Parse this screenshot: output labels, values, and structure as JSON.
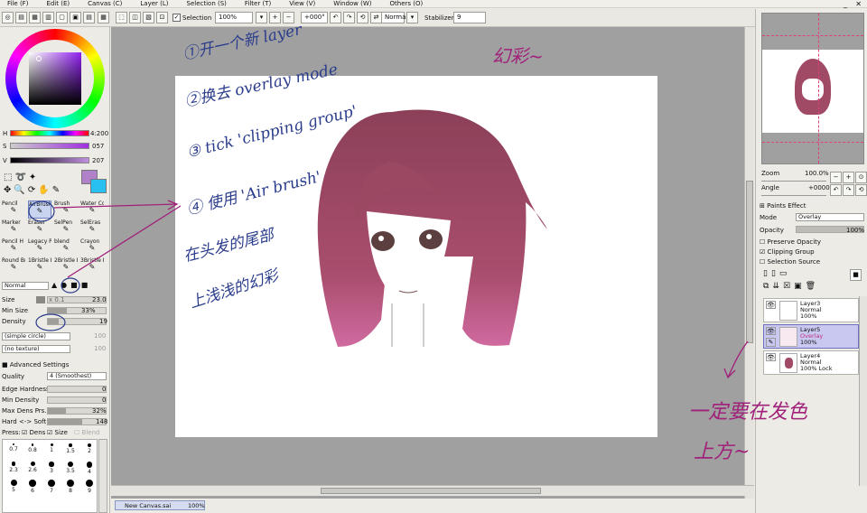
{
  "menu": [
    "File (F)",
    "Edit (E)",
    "Canvas (C)",
    "Layer (L)",
    "Selection (S)",
    "Filter (T)",
    "View (V)",
    "Window (W)",
    "Others (O)"
  ],
  "toolbar": {
    "selection_label": "Selection",
    "zoom_value": "100%",
    "rotation_value": "+000°",
    "blend_value": "Normal",
    "stabilizer_label": "Stabilizer",
    "stabilizer_value": "9"
  },
  "color": {
    "h_label": "H",
    "h_value": "4:200",
    "s_label": "S",
    "s_value": "057",
    "v_label": "V",
    "v_value": "207",
    "primary": "#b080c8",
    "secondary": "#28c0f0"
  },
  "brushes": [
    {
      "name": "Pencil"
    },
    {
      "name": "AirBrush"
    },
    {
      "name": "Brush"
    },
    {
      "name": "Water Color"
    },
    {
      "name": "Marker"
    },
    {
      "name": "Eraser"
    },
    {
      "name": "SelPen"
    },
    {
      "name": "SelEras"
    },
    {
      "name": "Pencil H"
    },
    {
      "name": "Legacy Pen"
    },
    {
      "name": "blend"
    },
    {
      "name": "Crayon"
    },
    {
      "name": "Round Brush"
    },
    {
      "name": "1Bristle Brush"
    },
    {
      "name": "2Bristle Brush"
    },
    {
      "name": "3Bristle Brush"
    }
  ],
  "brush_settings": {
    "mode": "Normal",
    "size_label": "Size",
    "size_mult": "x 0.1",
    "size_value": "23.0",
    "minsize_label": "Min Size",
    "minsize_value": "33%",
    "density_label": "Density",
    "density_value": "19",
    "shape": "(simple circle)",
    "shape_value": "100",
    "texture": "(no texture)",
    "texture_value": "100",
    "advanced_label": "Advanced Settings",
    "quality_label": "Quality",
    "quality_value": "4 (Smoothest)",
    "edge_label": "Edge Hardness",
    "edge_value": "0",
    "mindens_label": "Min Density",
    "mindens_value": "0",
    "maxdens_label": "Max Dens Prs.",
    "maxdens_value": "32%",
    "hardsoft_label": "Hard <-> Soft",
    "hardsoft_value": "148",
    "press_label": "Press:",
    "press_dens": "Dens",
    "press_size": "Size",
    "press_blend": "Blend"
  },
  "size_presets": [
    "0.7",
    "0.8",
    "1",
    "1.5",
    "2",
    "2.3",
    "2.6",
    "3",
    "3.5",
    "4",
    "5",
    "6",
    "7",
    "8",
    "9"
  ],
  "navigator": {
    "zoom_label": "Zoom",
    "zoom_value": "100.0%",
    "angle_label": "Angle",
    "angle_value": "+0000"
  },
  "layer_panel": {
    "paints_effect": "Paints Effect",
    "mode_label": "Mode",
    "mode_value": "Overlay",
    "opacity_label": "Opacity",
    "opacity_value": "100%",
    "preserve_opacity": "Preserve Opacity",
    "clipping_group": "Clipping Group",
    "selection_source": "Selection Source",
    "layers": [
      {
        "name": "Layer3",
        "mode": "Normal",
        "opacity": "100%"
      },
      {
        "name": "Layer5",
        "mode": "Overlay",
        "opacity": "100%"
      },
      {
        "name": "Layer4",
        "mode": "Normal",
        "opacity": "100% Lock"
      }
    ]
  },
  "status": {
    "doc_name": "New Canvas.sai",
    "doc_zoom": "100%"
  },
  "annotations": {
    "step1": "①开一个新 layer",
    "step2": "②换去 overlay mode",
    "step3": "③ tick 'clipping group'",
    "step4": "④ 使用 'Air brush'",
    "hair1": "在头发的尾部",
    "hair2": "上浅浅的幻彩",
    "title": "幻彩~",
    "note1": "一定要在发色",
    "note2": "上方~"
  },
  "accent_colors": {
    "ink": "#2a3c8c",
    "magenta": "#a0207a",
    "hair": "#a84c6c"
  }
}
